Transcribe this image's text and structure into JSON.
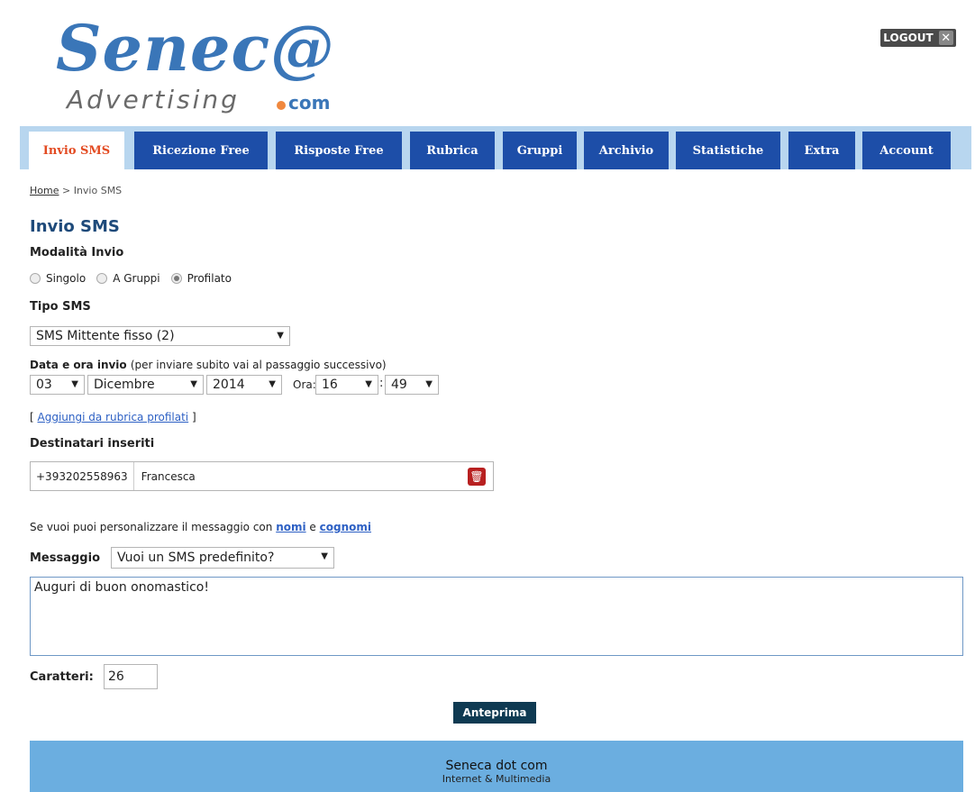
{
  "logo": {
    "main": "Senec@",
    "sub": "Advertising",
    "com": "com"
  },
  "logout": {
    "label": "LOGOUT",
    "icon": "close-icon"
  },
  "nav": {
    "tabs": [
      {
        "label": "Invio SMS",
        "active": true
      },
      {
        "label": "Ricezione Free"
      },
      {
        "label": "Risposte Free"
      },
      {
        "label": "Rubrica"
      },
      {
        "label": "Gruppi"
      },
      {
        "label": "Archivio"
      },
      {
        "label": "Statistiche"
      },
      {
        "label": "Extra"
      },
      {
        "label": "Account"
      }
    ]
  },
  "breadcrumb": {
    "home": "Home",
    "separator": " > ",
    "current": "Invio SMS"
  },
  "page": {
    "title": "Invio SMS",
    "mode_label": "Modalità Invio",
    "modes": [
      {
        "label": "Singolo",
        "checked": false
      },
      {
        "label": "A Gruppi",
        "checked": false
      },
      {
        "label": "Profilato",
        "checked": true
      }
    ],
    "type_label": "Tipo SMS",
    "type_value": "SMS Mittente fisso (2)",
    "date_label": "Data e ora invio",
    "date_hint": "(per inviare subito vai al passaggio successivo)",
    "day": "03",
    "month": "Dicembre",
    "year": "2014",
    "time_label": "Ora:",
    "hour": "16",
    "time_sep": ":",
    "minute": "49",
    "add_link_open": "[ ",
    "add_link": "Aggiungi da rubrica profilati",
    "add_link_close": " ]",
    "recipients_label": "Destinatari inseriti",
    "recipient_phone": "+393202558963",
    "recipient_name": "Francesca",
    "personal_text": "Se vuoi puoi personalizzare il messaggio con ",
    "personal_nomi": "nomi",
    "personal_and": " e ",
    "personal_cognomi": "cognomi",
    "message_label": "Messaggio",
    "message_select": "Vuoi un SMS predefinito?",
    "message_text": "Auguri di buon onomastico!",
    "chars_label": "Caratteri:",
    "chars_value": "26",
    "preview_button": "Anteprima"
  },
  "footer": {
    "line1": "Seneca dot com",
    "line2": "Internet & Multimedia"
  },
  "colors": {
    "nav_bg": "#b8d6ef",
    "tab_bg": "#1d4ea8",
    "active_text": "#e34b22",
    "footer_bg": "#6baee0",
    "button_bg": "#0f3a52"
  }
}
